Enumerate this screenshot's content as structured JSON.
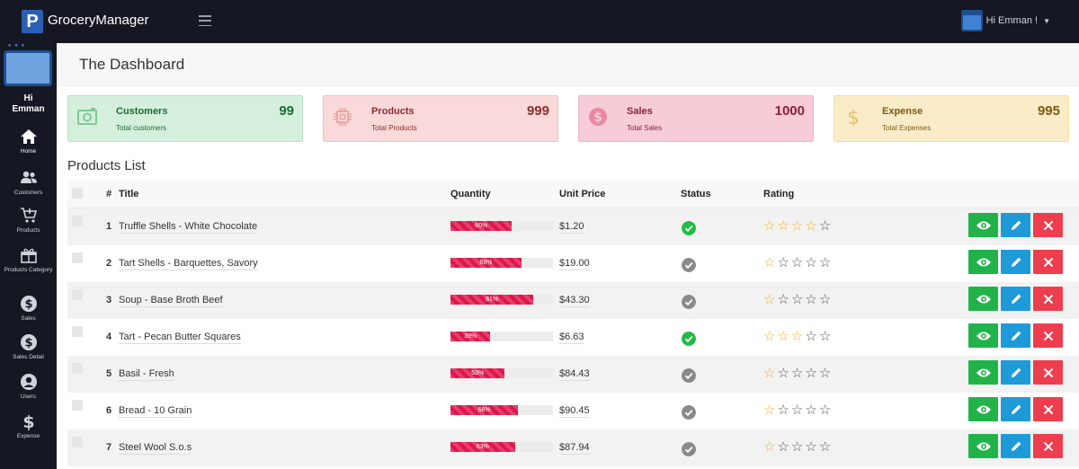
{
  "app": {
    "brand_letter": "P",
    "name": "GroceryManager"
  },
  "header": {
    "greeting": "Hi Emman !"
  },
  "sidebar": {
    "greeting_line1": "Hi",
    "greeting_line2": "Emman",
    "items": [
      {
        "label": "Home",
        "icon": "home-icon"
      },
      {
        "label": "Customers",
        "icon": "users-icon"
      },
      {
        "label": "Products",
        "icon": "cart-icon"
      },
      {
        "label": "Products Category",
        "icon": "gift-icon"
      },
      {
        "label": "Sales",
        "icon": "dollar-circle-icon"
      },
      {
        "label": "Sales Detail",
        "icon": "dollar-circle-icon"
      },
      {
        "label": "Users",
        "icon": "user-circle-icon"
      },
      {
        "label": "Expense",
        "icon": "dollar-icon"
      }
    ]
  },
  "page": {
    "title": "The Dashboard"
  },
  "cards": [
    {
      "title": "Customers",
      "subtitle": "Total customers",
      "value": "99",
      "bg": "#d4f0dc",
      "border": "#b7e2c4",
      "fg": "#1d6a34",
      "icon": "wallet-icon"
    },
    {
      "title": "Products",
      "subtitle": "Total Products",
      "value": "999",
      "bg": "#f9d9d9",
      "border": "#f0c2c2",
      "fg": "#8a2e2e",
      "icon": "chip-icon"
    },
    {
      "title": "Sales",
      "subtitle": "Total Sales",
      "value": "1000",
      "bg": "#f6ccd7",
      "border": "#eeb7c5",
      "fg": "#8a1f3b",
      "icon": "dollar-circle-icon"
    },
    {
      "title": "Expense",
      "subtitle": "Total Expenses",
      "value": "995",
      "bg": "#fbecc9",
      "border": "#f3dea9",
      "fg": "#7a5a10",
      "icon": "dollar-icon"
    }
  ],
  "products_list": {
    "title": "Products List",
    "columns": [
      "#",
      "Title",
      "Quantity",
      "Unit Price",
      "Status",
      "Rating"
    ],
    "rows": [
      {
        "num": "1",
        "title": "Truffle Shells - White Chocolate",
        "qty_label": "60%",
        "qty": 0.6,
        "price": "$1.20",
        "status": "active",
        "rating": 4
      },
      {
        "num": "2",
        "title": "Tart Shells - Barquettes, Savory",
        "qty_label": "69%",
        "qty": 0.69,
        "price": "$19.00",
        "status": "inactive",
        "rating": 1
      },
      {
        "num": "3",
        "title": "Soup - Base Broth Beef",
        "qty_label": "81%",
        "qty": 0.81,
        "price": "$43.30",
        "status": "inactive",
        "rating": 1
      },
      {
        "num": "4",
        "title": "Tart - Pecan Butter Squares",
        "qty_label": "39%",
        "qty": 0.39,
        "price": "$6.63",
        "status": "active",
        "rating": 3
      },
      {
        "num": "5",
        "title": "Basil - Fresh",
        "qty_label": "53%",
        "qty": 0.53,
        "price": "$84.43",
        "status": "inactive",
        "rating": 1
      },
      {
        "num": "6",
        "title": "Bread - 10 Grain",
        "qty_label": "66%",
        "qty": 0.66,
        "price": "$90.45",
        "status": "inactive",
        "rating": 1
      },
      {
        "num": "7",
        "title": "Steel Wool S.o.s",
        "qty_label": "63%",
        "qty": 0.63,
        "price": "$87.94",
        "status": "inactive",
        "rating": 1
      }
    ]
  },
  "colors": {
    "status_active": "#22bb45",
    "status_inactive": "#8a8a8a"
  }
}
